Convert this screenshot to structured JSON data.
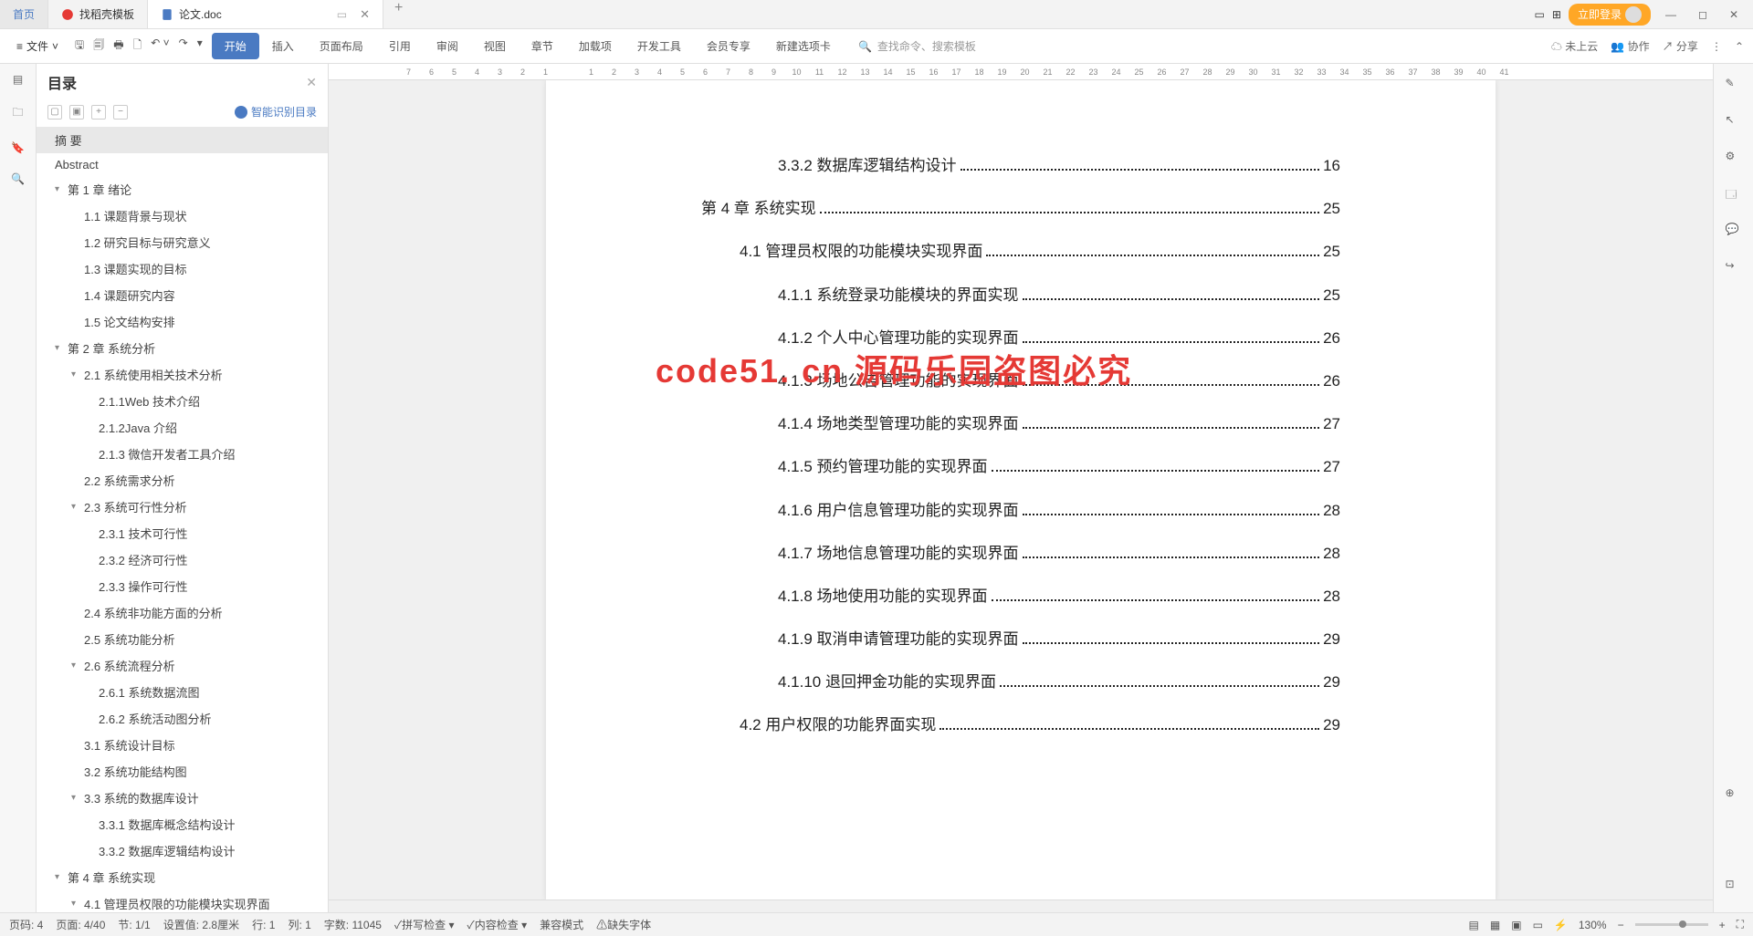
{
  "tabs": {
    "home": "首页",
    "tpl": "找稻壳模板",
    "doc": "论文.doc"
  },
  "login": "立即登录",
  "menu": {
    "file": "文件",
    "start": "开始",
    "insert": "插入",
    "layout": "页面布局",
    "ref": "引用",
    "review": "审阅",
    "view": "视图",
    "chapter": "章节",
    "plugin": "加载项",
    "dev": "开发工具",
    "vip": "会员专享",
    "newtab": "新建选项卡"
  },
  "search_ph": "查找命令、搜索模板",
  "cloud": "未上云",
  "collab": "协作",
  "share": "分享",
  "outline": {
    "title": "目录",
    "smart": "智能识别目录"
  },
  "toc": [
    {
      "l": 0,
      "t": "摘 要",
      "sel": true
    },
    {
      "l": 0,
      "t": "Abstract"
    },
    {
      "l": 1,
      "t": "第 1 章  绪论",
      "e": true
    },
    {
      "l": 2,
      "t": "1.1 课题背景与现状"
    },
    {
      "l": 2,
      "t": "1.2 研究目标与研究意义"
    },
    {
      "l": 2,
      "t": "1.3 课题实现的目标"
    },
    {
      "l": 2,
      "t": "1.4  课题研究内容"
    },
    {
      "l": 2,
      "t": "1.5  论文结构安排"
    },
    {
      "l": 1,
      "t": "第 2 章  系统分析",
      "e": true
    },
    {
      "l": 2,
      "t": "2.1 系统使用相关技术分析",
      "e": true
    },
    {
      "l": 3,
      "t": "2.1.1Web 技术介绍"
    },
    {
      "l": 3,
      "t": "2.1.2Java 介绍"
    },
    {
      "l": 3,
      "t": "2.1.3 微信开发者工具介绍"
    },
    {
      "l": 2,
      "t": "2.2 系统需求分析"
    },
    {
      "l": 2,
      "t": "2.3 系统可行性分析",
      "e": true
    },
    {
      "l": 3,
      "t": "2.3.1 技术可行性"
    },
    {
      "l": 3,
      "t": "2.3.2 经济可行性"
    },
    {
      "l": 3,
      "t": "2.3.3 操作可行性"
    },
    {
      "l": 2,
      "t": "2.4 系统非功能方面的分析"
    },
    {
      "l": 2,
      "t": "2.5 系统功能分析"
    },
    {
      "l": 2,
      "t": "2.6 系统流程分析",
      "e": true
    },
    {
      "l": 3,
      "t": "2.6.1 系统数据流图"
    },
    {
      "l": 3,
      "t": "2.6.2 系统活动图分析"
    },
    {
      "l": 2,
      "t": "3.1 系统设计目标"
    },
    {
      "l": 2,
      "t": "3.2 系统功能结构图"
    },
    {
      "l": 2,
      "t": "3.3 系统的数据库设计",
      "e": true
    },
    {
      "l": 3,
      "t": "3.3.1 数据库概念结构设计"
    },
    {
      "l": 3,
      "t": "3.3.2 数据库逻辑结构设计"
    },
    {
      "l": 1,
      "t": "第 4 章  系统实现",
      "e": true
    },
    {
      "l": 2,
      "t": "4.1 管理员权限的功能模块实现界面",
      "e": true
    }
  ],
  "doc": [
    {
      "l": "h3",
      "t": "3.3.2 数据库逻辑结构设计",
      "p": "16"
    },
    {
      "l": "h1",
      "t": "第 4 章  系统实现",
      "p": "25"
    },
    {
      "l": "h2",
      "t": "4.1 管理员权限的功能模块实现界面",
      "p": "25"
    },
    {
      "l": "h3",
      "t": "4.1.1 系统登录功能模块的界面实现",
      "p": "25"
    },
    {
      "l": "h3",
      "t": "4.1.2 个人中心管理功能的实现界面",
      "p": "26"
    },
    {
      "l": "h3",
      "t": "4.1.3 场地公告管理功能的实现界面",
      "p": "26"
    },
    {
      "l": "h3",
      "t": "4.1.4 场地类型管理功能的实现界面",
      "p": "27"
    },
    {
      "l": "h3",
      "t": "4.1.5 预约管理功能的实现界面",
      "p": "27"
    },
    {
      "l": "h3",
      "t": "4.1.6 用户信息管理功能的实现界面",
      "p": "28"
    },
    {
      "l": "h3",
      "t": "4.1.7 场地信息管理功能的实现界面",
      "p": "28"
    },
    {
      "l": "h3",
      "t": "4.1.8 场地使用功能的实现界面",
      "p": "28"
    },
    {
      "l": "h3",
      "t": "4.1.9 取消申请管理功能的实现界面",
      "p": "29"
    },
    {
      "l": "h3",
      "t": "4.1.10 退回押金功能的实现界面",
      "p": "29"
    },
    {
      "l": "h2",
      "t": "4.2 用户权限的功能界面实现",
      "p": "29"
    }
  ],
  "watermark": "code51. cn  源码乐园盗图必究",
  "status": {
    "pageno": "页码: 4",
    "page": "页面: 4/40",
    "sec": "节: 1/1",
    "setval": "设置值: 2.8厘米",
    "row": "行: 1",
    "col": "列: 1",
    "words": "字数: 11045",
    "spell": "拼写检查",
    "content": "内容检查",
    "compat": "兼容模式",
    "font": "缺失字体",
    "zoom": "130%"
  },
  "ruler": [
    " ",
    "7",
    "6",
    "5",
    "4",
    "3",
    "2",
    "1",
    " ",
    "1",
    "2",
    "3",
    "4",
    "5",
    "6",
    "7",
    "8",
    "9",
    "10",
    "11",
    "12",
    "13",
    "14",
    "15",
    "16",
    "17",
    "18",
    "19",
    "20",
    "21",
    "22",
    "23",
    "24",
    "25",
    "26",
    "27",
    "28",
    "29",
    "30",
    "31",
    "32",
    "33",
    "34",
    "35",
    "36",
    "37",
    "38",
    "39",
    "40",
    "41"
  ]
}
